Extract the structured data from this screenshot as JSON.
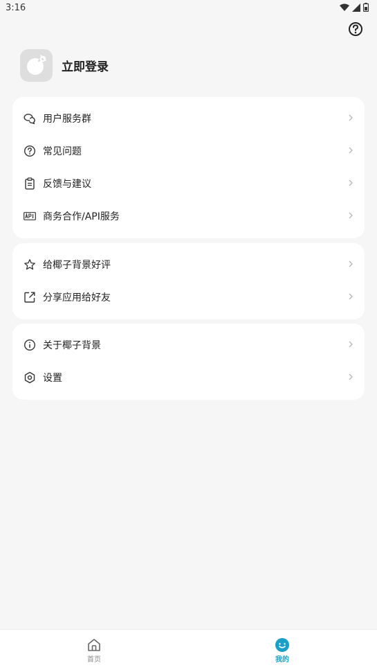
{
  "status_bar": {
    "time": "3:16"
  },
  "profile": {
    "login_label": "立即登录"
  },
  "menu_groups": [
    {
      "items": [
        {
          "icon": "chat-bubbles-icon",
          "label": "用户服务群"
        },
        {
          "icon": "question-circle-icon",
          "label": "常见问题"
        },
        {
          "icon": "clipboard-icon",
          "label": "反馈与建议"
        },
        {
          "icon": "api-icon",
          "label": "商务合作/API服务"
        }
      ]
    },
    {
      "items": [
        {
          "icon": "star-icon",
          "label": "给椰子背景好评"
        },
        {
          "icon": "share-icon",
          "label": "分享应用给好友"
        }
      ]
    },
    {
      "items": [
        {
          "icon": "info-icon",
          "label": "关于椰子背景"
        },
        {
          "icon": "gear-icon",
          "label": "设置"
        }
      ]
    }
  ],
  "bottom_nav": {
    "home_label": "首页",
    "mine_label": "我的",
    "active_color": "#1aa0c8",
    "inactive_color": "#8a8a8a"
  }
}
